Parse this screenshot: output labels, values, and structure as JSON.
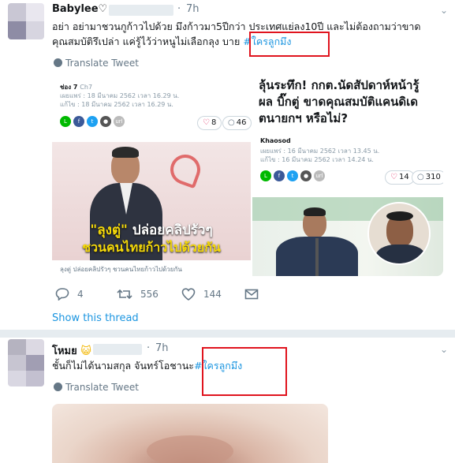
{
  "tweet1": {
    "name": "Babylee♡",
    "time_sep": "·",
    "time": "7h",
    "text_line1": "อย่า อย่ามาชวนกูก้าวไปด้วย มึงก้าวมา5ปีกว่า ประเทศแย่ลง10ปี และไม่ต้องถามว่าขาด",
    "text_line2": "คุณสมบัติรึเปล่า แค่รู้ไว้ว่าหนูไม่เลือกลุง บาย",
    "hashtag": "#ใครลูกมึง",
    "translate_label": "Translate Tweet",
    "card_left": {
      "source": "ช่อง 7",
      "source_sub": "Ch7",
      "published": "เผยแพร่ : 18 มีนาคม 2562 เวลา 16.29 น.",
      "updated": "แก้ไข : 18 มีนาคม 2562 เวลา 16.29 น.",
      "likes": "8",
      "comments": "46",
      "overlay_line1_quote": "\"ลุงตู่\"",
      "overlay_line1_rest": "ปล่อยคลิปรัวๆ",
      "overlay_line2": "ชวนคนไทยก้าวไปด้วยกัน",
      "caption": "ลุงตู่ ปล่อยคลิปรัวๆ ชวนคนไทยก้าวไปด้วยกัน"
    },
    "card_right": {
      "headline_line1": "ลุ้นระทึก! กกต.นัดสัปดาห์หน้ารู้",
      "headline_line2": "ผล บิ๊กตู่ ขาดคุณสมบัติแคนดิเด",
      "headline_line3": "ตนายกฯ หรือไม่?",
      "source": "Khaosod",
      "published": "เผยแพร่ : 16 มีนาคม 2562 เวลา 13.45 น.",
      "updated": "แก้ไข : 16 มีนาคม 2562 เวลา 14.24 น.",
      "likes": "14",
      "comments": "310"
    },
    "actions": {
      "replies": "4",
      "retweets": "556",
      "likes": "144"
    },
    "show_thread": "Show this thread"
  },
  "tweet2": {
    "name": "โหมย",
    "name_emoji": "😺",
    "time_sep": "·",
    "time": "7h",
    "text": "ชั้นก็ไม่ได้นามสกุล จันทร์โอชานะ",
    "hashtag": "#ใครลูกมึง",
    "translate_label": "Translate Tweet"
  },
  "share_icons": [
    "line-icon",
    "facebook-icon",
    "twitter-icon",
    "save-icon",
    "url-icon"
  ],
  "colors": {
    "hashtag": "#1b95e0",
    "highlight_box": "#e0141e",
    "muted": "#657786",
    "divider": "#e6ecf0",
    "overlay_yellow": "#f5d90a"
  }
}
